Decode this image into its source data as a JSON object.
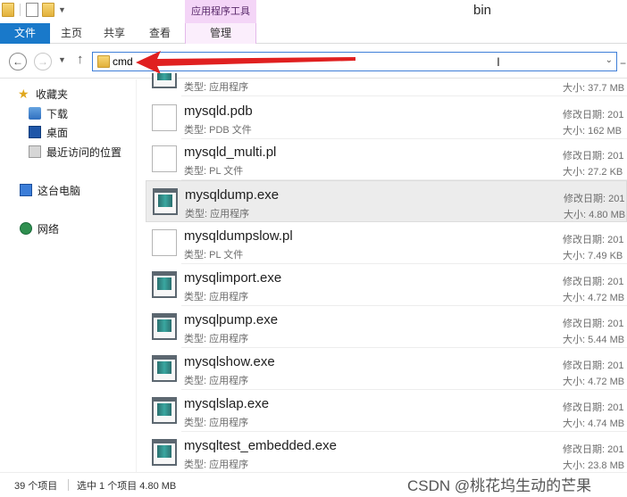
{
  "window": {
    "title": "bin",
    "context_tab_title": "应用程序工具"
  },
  "ribbon": {
    "tabs": [
      "文件",
      "主页",
      "共享",
      "查看",
      "管理"
    ]
  },
  "address_bar": {
    "value": "cmd"
  },
  "sidebar": {
    "items": [
      {
        "label": "收藏夹",
        "icon": "star-icon"
      },
      {
        "label": "下载",
        "icon": "downloads-icon"
      },
      {
        "label": "桌面",
        "icon": "desktop-icon"
      },
      {
        "label": "最近访问的位置",
        "icon": "recent-places-icon"
      },
      {
        "label": "这台电脑",
        "icon": "this-pc-icon"
      },
      {
        "label": "网络",
        "icon": "network-icon"
      }
    ]
  },
  "files": [
    {
      "name": "",
      "type": "类型: 应用程序",
      "date": "",
      "size": "大小: 37.7 MB",
      "icon": "exe-icon"
    },
    {
      "name": "mysqld.pdb",
      "type": "类型: PDB 文件",
      "date": "修改日期: 201",
      "size": "大小: 162 MB",
      "icon": "file-icon"
    },
    {
      "name": "mysqld_multi.pl",
      "type": "类型: PL 文件",
      "date": "修改日期: 201",
      "size": "大小: 27.2 KB",
      "icon": "file-icon"
    },
    {
      "name": "mysqldump.exe",
      "type": "类型: 应用程序",
      "date": "修改日期: 201",
      "size": "大小: 4.80 MB",
      "icon": "exe-icon",
      "selected": true
    },
    {
      "name": "mysqldumpslow.pl",
      "type": "类型: PL 文件",
      "date": "修改日期: 201",
      "size": "大小: 7.49 KB",
      "icon": "file-icon"
    },
    {
      "name": "mysqlimport.exe",
      "type": "类型: 应用程序",
      "date": "修改日期: 201",
      "size": "大小: 4.72 MB",
      "icon": "exe-icon"
    },
    {
      "name": "mysqlpump.exe",
      "type": "类型: 应用程序",
      "date": "修改日期: 201",
      "size": "大小: 5.44 MB",
      "icon": "exe-icon"
    },
    {
      "name": "mysqlshow.exe",
      "type": "类型: 应用程序",
      "date": "修改日期: 201",
      "size": "大小: 4.72 MB",
      "icon": "exe-icon"
    },
    {
      "name": "mysqlslap.exe",
      "type": "类型: 应用程序",
      "date": "修改日期: 201",
      "size": "大小: 4.74 MB",
      "icon": "exe-icon"
    },
    {
      "name": "mysqltest_embedded.exe",
      "type": "类型: 应用程序",
      "date": "修改日期: 201",
      "size": "大小: 23.8 MB",
      "icon": "exe-icon"
    }
  ],
  "status": {
    "count": "39 个项目",
    "selection": "选中 1 个项目  4.80 MB"
  },
  "watermark": "CSDN @桃花坞生动的芒果",
  "colors": {
    "file_tab": "#1979ca",
    "context_tab": "#f4d5f7",
    "annotation_arrow": "#e02020",
    "selection": "#ececec"
  }
}
